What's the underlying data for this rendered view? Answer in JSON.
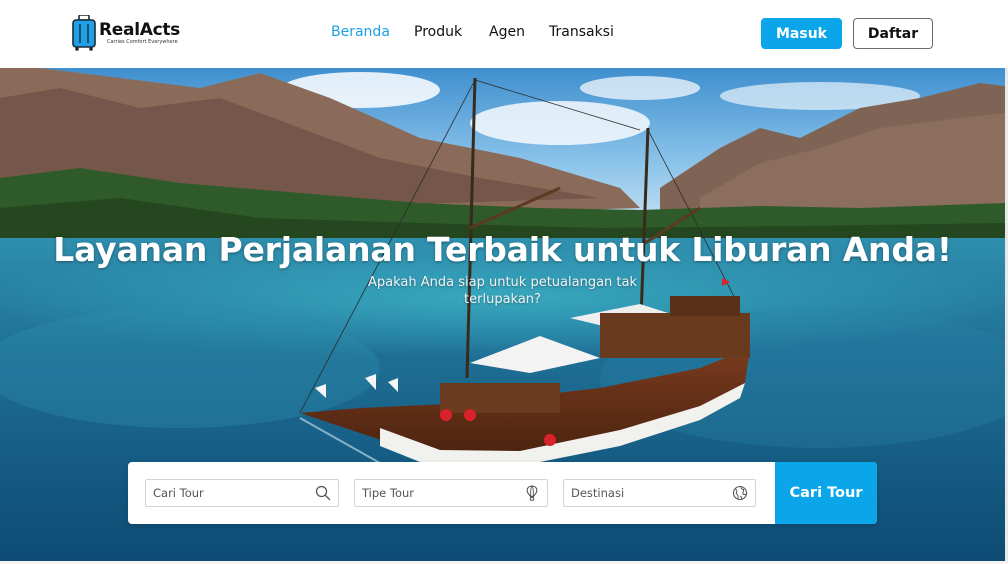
{
  "brand": {
    "name": "RealActs",
    "tagline": "Carries Comfort Everywhere",
    "accent_color": "#0ba6ea"
  },
  "nav": {
    "items": [
      {
        "label": "Beranda",
        "active": true
      },
      {
        "label": "Produk",
        "active": false
      },
      {
        "label": "Agen",
        "active": false
      },
      {
        "label": "Transaksi",
        "active": false
      }
    ],
    "login_label": "Masuk",
    "register_label": "Daftar"
  },
  "hero": {
    "title": "Layanan Perjalanan Terbaik untuk Liburan Anda!",
    "subtitle": "Apakah Anda siap untuk petualangan tak terlupakan?",
    "background": "phinisi-boat-island-sea-photo"
  },
  "search": {
    "tour_placeholder": "Cari Tour",
    "tour_icon": "search-icon",
    "type_placeholder": "Tipe Tour",
    "type_icon": "hot-air-balloon-icon",
    "destination_placeholder": "Destinasi",
    "destination_icon": "globe-icon",
    "submit_label": "Cari Tour"
  }
}
